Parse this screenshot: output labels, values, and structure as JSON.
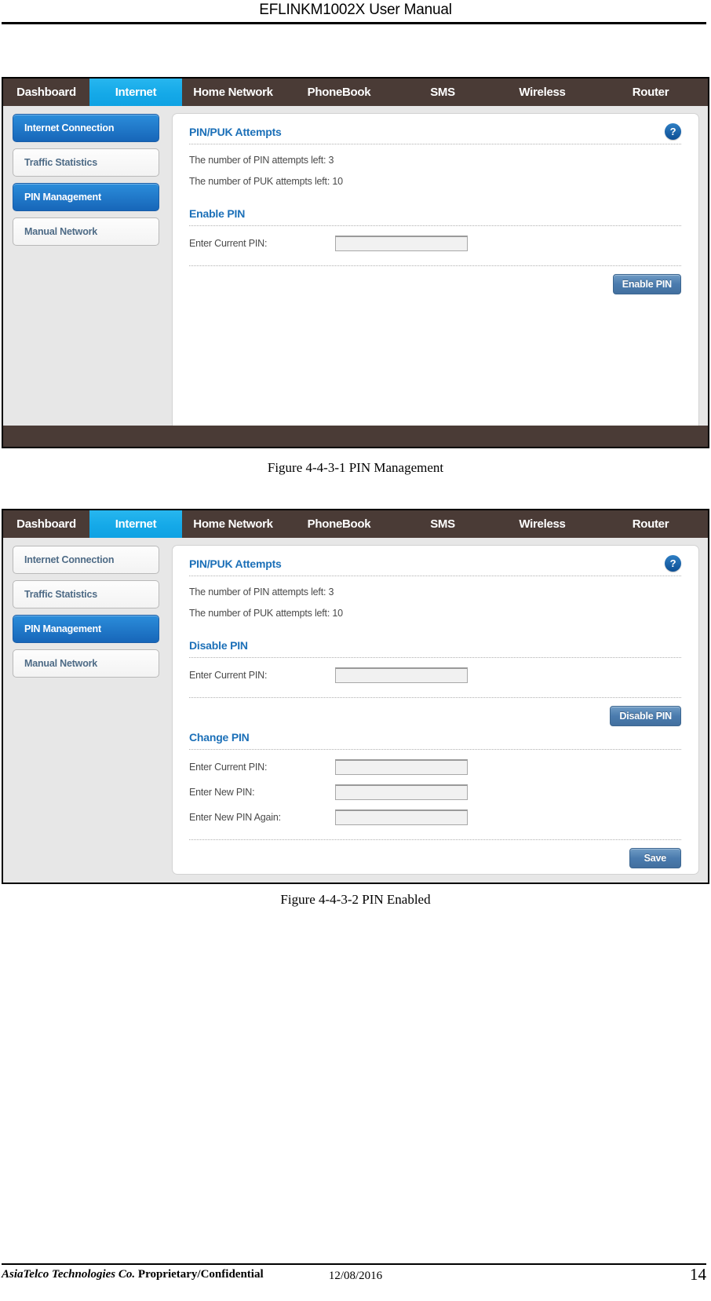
{
  "document": {
    "header_title": "EFLINKM1002X User Manual",
    "footer_company": "AsiaTelco Technologies Co.",
    "footer_classification": "Proprietary/Confidential",
    "footer_date": "12/08/2016",
    "page_number": "14"
  },
  "captions": {
    "figure_1": "Figure 4-4-3-1 PIN Management",
    "figure_2": "Figure 4-4-3-2 PIN Enabled"
  },
  "colors": {
    "navbar_bg": "#4a3b36",
    "nav_active": "#15a9e8",
    "sidebar_active": "#1766b9",
    "heading_blue": "#1c70b8",
    "button_blue": "#4a7bae"
  },
  "nav": {
    "items": [
      {
        "label": "Dashboard",
        "active": false
      },
      {
        "label": "Internet",
        "active": true
      },
      {
        "label": "Home Network",
        "active": false
      },
      {
        "label": "PhoneBook",
        "active": false
      },
      {
        "label": "SMS",
        "active": false
      },
      {
        "label": "Wireless",
        "active": false
      },
      {
        "label": "Router",
        "active": false
      }
    ]
  },
  "screenshot_1": {
    "sidebar": {
      "items": [
        {
          "label": "Internet Connection",
          "active": true
        },
        {
          "label": "Traffic Statistics",
          "active": false
        },
        {
          "label": "PIN Management",
          "active": true
        },
        {
          "label": "Manual Network",
          "active": false
        }
      ]
    },
    "attempts_section": {
      "heading": "PIN/PUK Attempts",
      "help_icon": "?",
      "pin_attempts_line": "The number of PIN attempts left: 3",
      "puk_attempts_line": "The number of PUK attempts left: 10"
    },
    "enable_pin_section": {
      "heading": "Enable PIN",
      "current_pin_label": "Enter Current PIN:",
      "current_pin_value": "",
      "current_pin_placeholder": "",
      "submit_label": "Enable PIN"
    }
  },
  "screenshot_2": {
    "sidebar": {
      "items": [
        {
          "label": "Internet Connection",
          "active": false
        },
        {
          "label": "Traffic Statistics",
          "active": false
        },
        {
          "label": "PIN Management",
          "active": true
        },
        {
          "label": "Manual Network",
          "active": false
        }
      ]
    },
    "attempts_section": {
      "heading": "PIN/PUK Attempts",
      "help_icon": "?",
      "pin_attempts_line": "The number of PIN attempts left: 3",
      "puk_attempts_line": "The number of PUK attempts left: 10"
    },
    "disable_pin_section": {
      "heading": "Disable PIN",
      "current_pin_label": "Enter Current PIN:",
      "current_pin_value": "",
      "current_pin_placeholder": "",
      "submit_label": "Disable PIN"
    },
    "change_pin_section": {
      "heading": "Change PIN",
      "current_pin_label": "Enter Current PIN:",
      "current_pin_value": "",
      "new_pin_label": "Enter New PIN:",
      "new_pin_value": "",
      "confirm_pin_label": "Enter New PIN Again:",
      "confirm_pin_value": "",
      "submit_label": "Save"
    }
  }
}
